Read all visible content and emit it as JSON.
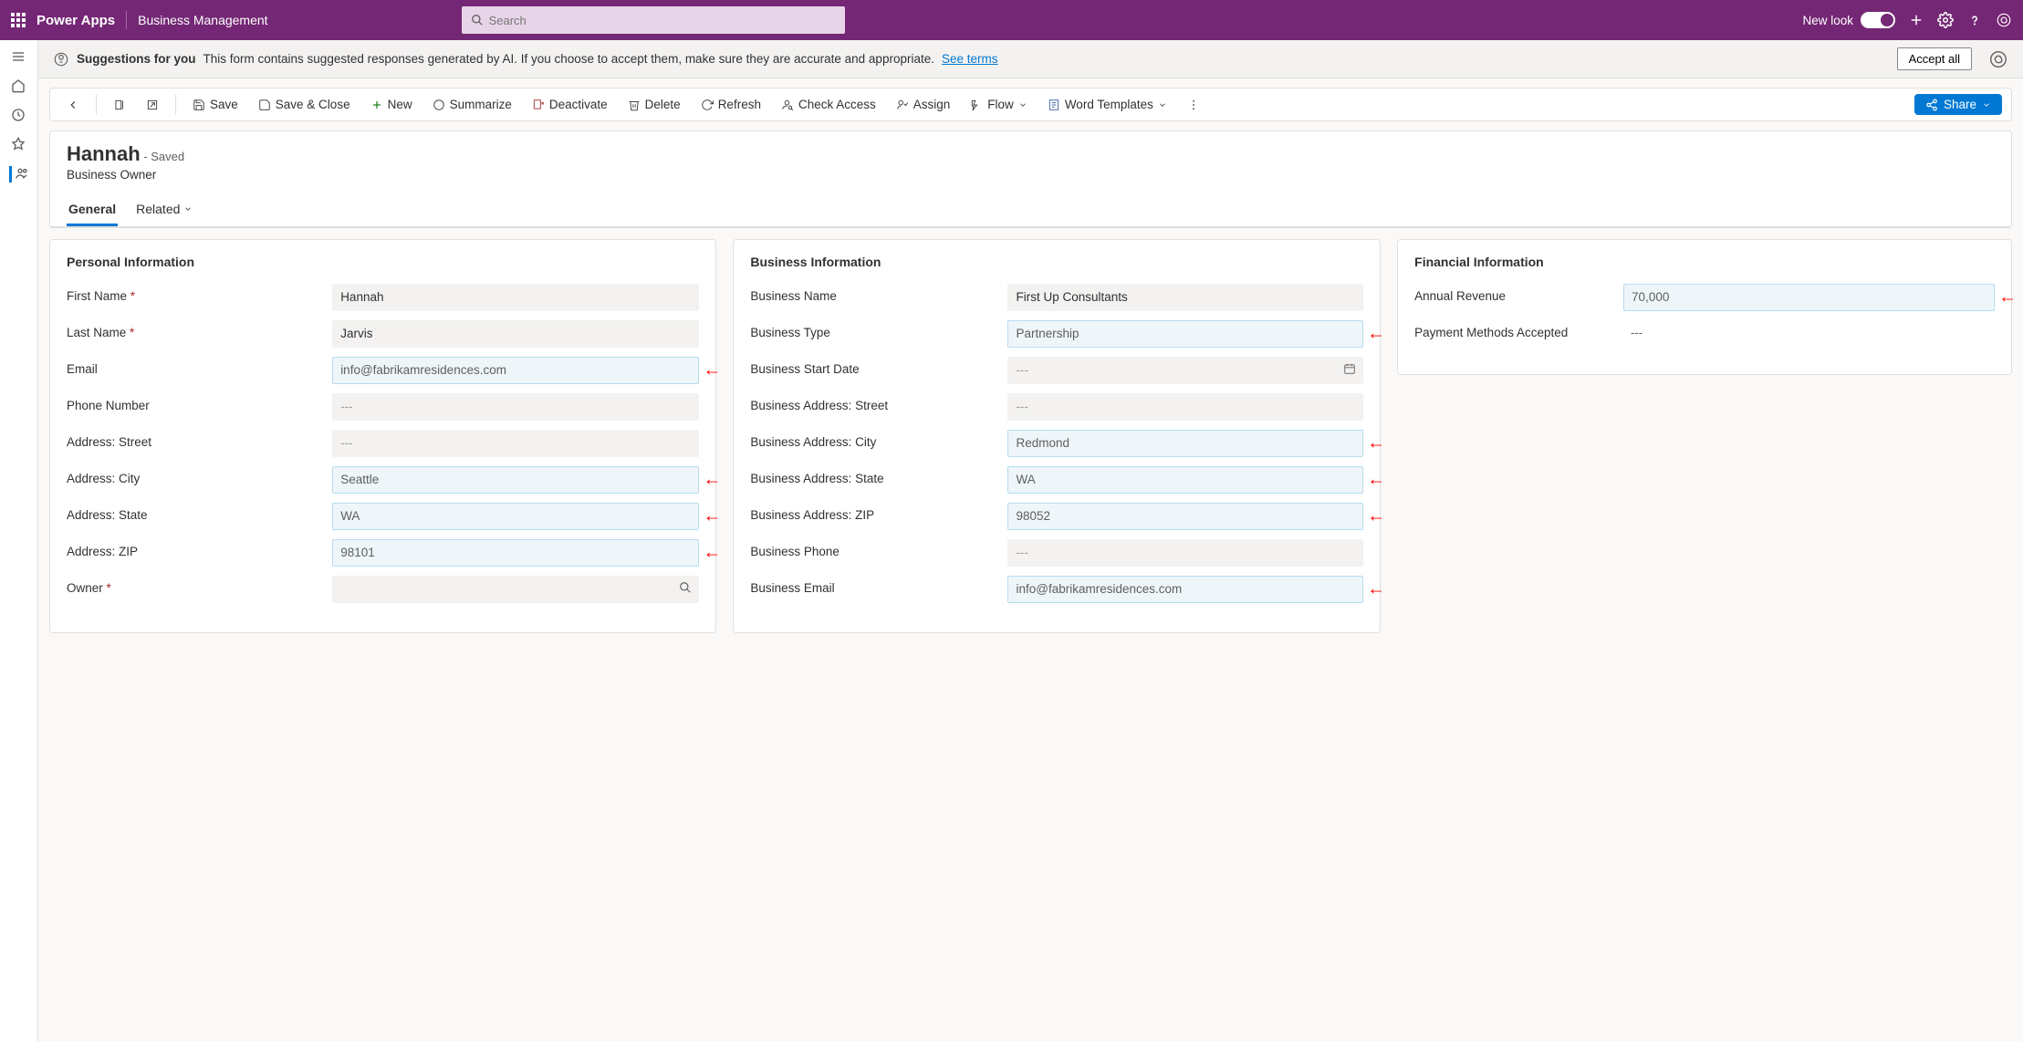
{
  "header": {
    "app_name": "Power Apps",
    "context": "Business Management",
    "search_placeholder": "Search",
    "new_look": "New look",
    "accept_all": "Accept all"
  },
  "suggestion": {
    "title": "Suggestions for you",
    "text": "This form contains suggested responses generated by AI. If you choose to accept them, make sure they are accurate and appropriate.",
    "link": "See terms"
  },
  "commands": {
    "back": "Back",
    "save": "Save",
    "save_close": "Save & Close",
    "new": "New",
    "summarize": "Summarize",
    "deactivate": "Deactivate",
    "delete": "Delete",
    "refresh": "Refresh",
    "check_access": "Check Access",
    "assign": "Assign",
    "flow": "Flow",
    "word_templates": "Word Templates",
    "share": "Share"
  },
  "record": {
    "title": "Hannah",
    "saved": "- Saved",
    "entity": "Business Owner",
    "tabs": {
      "general": "General",
      "related": "Related"
    }
  },
  "form": {
    "personal": {
      "title": "Personal Information",
      "first_name_label": "First Name",
      "first_name": "Hannah",
      "last_name_label": "Last Name",
      "last_name": "Jarvis",
      "email_label": "Email",
      "email": "info@fabrikamresidences.com",
      "phone_label": "Phone Number",
      "phone": "---",
      "addr_street_label": "Address: Street",
      "addr_street": "---",
      "addr_city_label": "Address: City",
      "addr_city": "Seattle",
      "addr_state_label": "Address: State",
      "addr_state": "WA",
      "addr_zip_label": "Address: ZIP",
      "addr_zip": "98101",
      "owner_label": "Owner",
      "owner": ""
    },
    "business": {
      "title": "Business Information",
      "name_label": "Business Name",
      "name": "First Up Consultants",
      "type_label": "Business Type",
      "type": "Partnership",
      "start_label": "Business Start Date",
      "start": "---",
      "addr_street_label": "Business Address: Street",
      "addr_street": "---",
      "addr_city_label": "Business Address: City",
      "addr_city": "Redmond",
      "addr_state_label": "Business Address: State",
      "addr_state": "WA",
      "addr_zip_label": "Business Address: ZIP",
      "addr_zip": "98052",
      "phone_label": "Business Phone",
      "phone": "---",
      "email_label": "Business Email",
      "email": "info@fabrikamresidences.com"
    },
    "financial": {
      "title": "Financial Information",
      "revenue_label": "Annual Revenue",
      "revenue": "70,000",
      "payment_label": "Payment Methods Accepted",
      "payment": "---"
    }
  }
}
